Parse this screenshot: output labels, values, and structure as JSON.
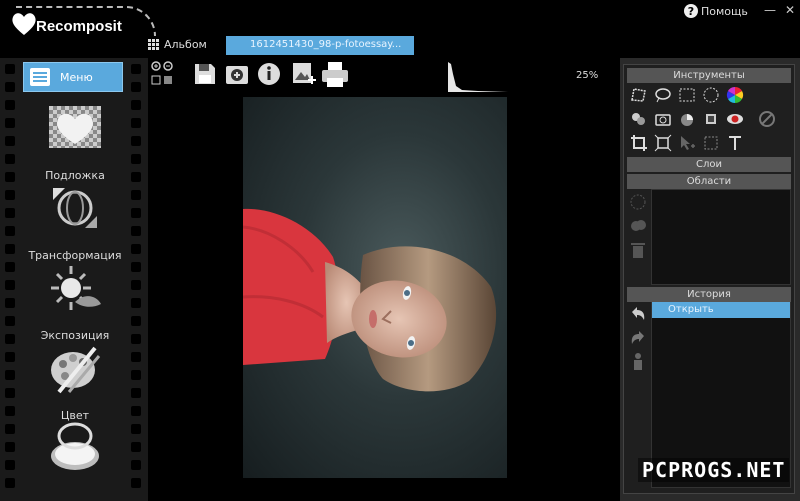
{
  "app": {
    "logo_text": "Recomposit"
  },
  "window": {
    "help_label": "Помощь",
    "minimize": "—",
    "close": "✕"
  },
  "album": {
    "label": "Альбом",
    "file_tab": "1612451430_98-p-fotoessay..."
  },
  "sidebar": {
    "menu_label": "Меню",
    "items": [
      {
        "label": "Подложка",
        "icon": "heart-pattern-icon"
      },
      {
        "label": "Трансформация",
        "icon": "transform-arrows-icon"
      },
      {
        "label": "Экспозиция",
        "icon": "exposure-sun-icon"
      },
      {
        "label": "Цвет",
        "icon": "palette-icon"
      },
      {
        "label": "",
        "icon": "mirror-compact-icon"
      }
    ]
  },
  "toolbar": {
    "icons": [
      "zoom-controls-icon",
      "save-icon",
      "add-photo-icon",
      "info-icon",
      "export-image-icon",
      "print-icon"
    ],
    "zoom_level": "25%"
  },
  "panel": {
    "tools_header": "Инструменты",
    "layers_header": "Слои",
    "areas_header": "Области",
    "history_header": "История",
    "history_items": [
      "Открыть"
    ],
    "tools": [
      "lasso-icon",
      "ellipse-lasso-icon",
      "rect-select-icon",
      "circle-select-icon",
      "color-wheel-icon",
      "clone-icon",
      "camera-icon",
      "magic-wand-icon",
      "select-tool-icon",
      "red-eye-icon",
      "no-icon",
      "crop-icon",
      "perspective-crop-icon",
      "cursor-add-icon",
      "frame-icon",
      "text-icon"
    ]
  },
  "watermark": "PCPROGS.NET",
  "colors": {
    "accent": "#5aa9dd",
    "panel_header": "#555555",
    "dress": "#d9363e"
  }
}
